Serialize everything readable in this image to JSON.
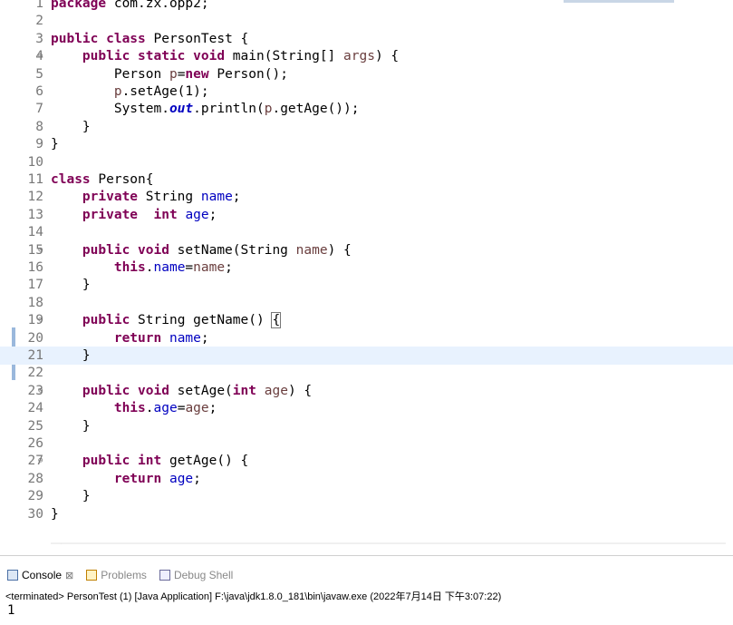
{
  "editor": {
    "lines": [
      {
        "n": "1",
        "fold": false,
        "html": "<span class=\"k\">package</span> com.zx.opp2;"
      },
      {
        "n": "2",
        "fold": false,
        "html": ""
      },
      {
        "n": "3",
        "fold": false,
        "html": "<span class=\"k\">public class</span> PersonTest {"
      },
      {
        "n": "4",
        "fold": true,
        "html": "    <span class=\"k\">public static void</span> main(String[] <span class=\"p\">args</span>) {"
      },
      {
        "n": "5",
        "fold": false,
        "html": "        Person <span class=\"p\">p</span>=<span class=\"k\">new</span> Person();"
      },
      {
        "n": "6",
        "fold": false,
        "html": "        <span class=\"p\">p</span>.setAge(1);"
      },
      {
        "n": "7",
        "fold": false,
        "html": "        System.<span class=\"fi\">out</span>.println(<span class=\"p\">p</span>.getAge());"
      },
      {
        "n": "8",
        "fold": false,
        "html": "    }"
      },
      {
        "n": "9",
        "fold": false,
        "html": "}"
      },
      {
        "n": "10",
        "fold": false,
        "html": ""
      },
      {
        "n": "11",
        "fold": false,
        "html": "<span class=\"k\">class</span> Person{"
      },
      {
        "n": "12",
        "fold": false,
        "html": "    <span class=\"k\">private</span> String <span class=\"f\">name</span>;"
      },
      {
        "n": "13",
        "fold": false,
        "html": "    <span class=\"k\">private</span>  <span class=\"k\">int</span> <span class=\"f\">age</span>;"
      },
      {
        "n": "14",
        "fold": false,
        "html": ""
      },
      {
        "n": "15",
        "fold": true,
        "html": "    <span class=\"k\">public void</span> setName(String <span class=\"p\">name</span>) {"
      },
      {
        "n": "16",
        "fold": false,
        "html": "        <span class=\"k\">this</span>.<span class=\"f\">name</span>=<span class=\"p\">name</span>;"
      },
      {
        "n": "17",
        "fold": false,
        "html": "    }"
      },
      {
        "n": "18",
        "fold": false,
        "html": ""
      },
      {
        "n": "19",
        "fold": true,
        "html": "    <span class=\"k\">public</span> String getName() <span class=\"brace\">{</span>"
      },
      {
        "n": "20",
        "fold": false,
        "html": "        <span class=\"k\">return</span> <span class=\"f\">name</span>;"
      },
      {
        "n": "21",
        "fold": false,
        "html": "    }",
        "current": true
      },
      {
        "n": "22",
        "fold": false,
        "html": ""
      },
      {
        "n": "23",
        "fold": true,
        "html": "    <span class=\"k\">public void</span> setAge(<span class=\"k\">int</span> <span class=\"p\">age</span>) {"
      },
      {
        "n": "24",
        "fold": false,
        "html": "        <span class=\"k\">this</span>.<span class=\"f\">age</span>=<span class=\"p\">age</span>;"
      },
      {
        "n": "25",
        "fold": false,
        "html": "    }"
      },
      {
        "n": "26",
        "fold": false,
        "html": ""
      },
      {
        "n": "27",
        "fold": true,
        "html": "    <span class=\"k\">public int</span> getAge() {"
      },
      {
        "n": "28",
        "fold": false,
        "html": "        <span class=\"k\">return</span> <span class=\"f\">age</span>;"
      },
      {
        "n": "29",
        "fold": false,
        "html": "    }"
      },
      {
        "n": "30",
        "fold": false,
        "html": "}"
      }
    ],
    "fold_glyph": "⊖",
    "scroll_left_glyph": "<"
  },
  "console": {
    "tabs": [
      {
        "label": "Console",
        "icon": "console-icon",
        "active": true,
        "close": "⊠"
      },
      {
        "label": "Problems",
        "icon": "problems-icon",
        "active": false
      },
      {
        "label": "Debug Shell",
        "icon": "debug-shell-icon",
        "active": false
      }
    ],
    "status": "<terminated> PersonTest (1) [Java Application] F:\\java\\jdk1.8.0_181\\bin\\javaw.exe (2022年7月14日 下午3:07:22)",
    "output": "1"
  }
}
